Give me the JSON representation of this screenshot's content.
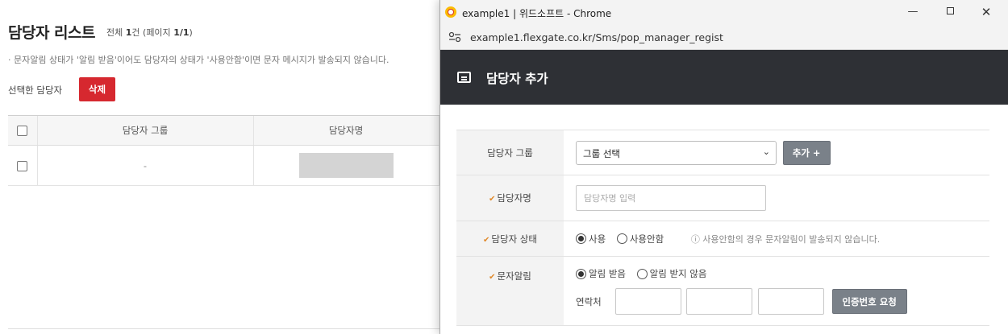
{
  "page": {
    "title": "담당자 리스트",
    "count_prefix": "전체",
    "count_value": "1",
    "count_suffix": "건 (페이지",
    "page_current": "1/1",
    "count_close": ")",
    "notice": "· 문자알림 상태가 '알림 받음'이어도 담당자의 상태가 '사용안함'이면 문자 메시지가 발송되지 않습니다.",
    "selected_label": "선택한 담당자",
    "delete_label": "삭제",
    "columns": [
      "담당자 그룹",
      "담당자명"
    ],
    "rows": [
      {
        "group": "-",
        "name": ""
      }
    ]
  },
  "popup": {
    "window_title": "example1 | 위드소프트 - Chrome",
    "url": "example1.flexgate.co.kr/Sms/pop_manager_regist",
    "header_title": "담당자 추가",
    "required_mark": "✔",
    "fields": {
      "group": {
        "label": "담당자 그룹",
        "selected": "그룹 선택",
        "add_label": "추가 +"
      },
      "name": {
        "label": "담당자명",
        "placeholder": "담당자명 입력"
      },
      "status": {
        "label": "담당자 상태",
        "option_on": "사용",
        "option_off": "사용안함",
        "selected": "사용",
        "note": "ⓘ 사용안함의 경우 문자알림이 발송되지 않습니다."
      },
      "sms": {
        "label": "문자알림",
        "option_on": "알림 받음",
        "option_off": "알림 받지 않음",
        "selected": "알림 받음",
        "contact_label": "연락처",
        "verify_label": "인증번호 요청"
      }
    }
  }
}
